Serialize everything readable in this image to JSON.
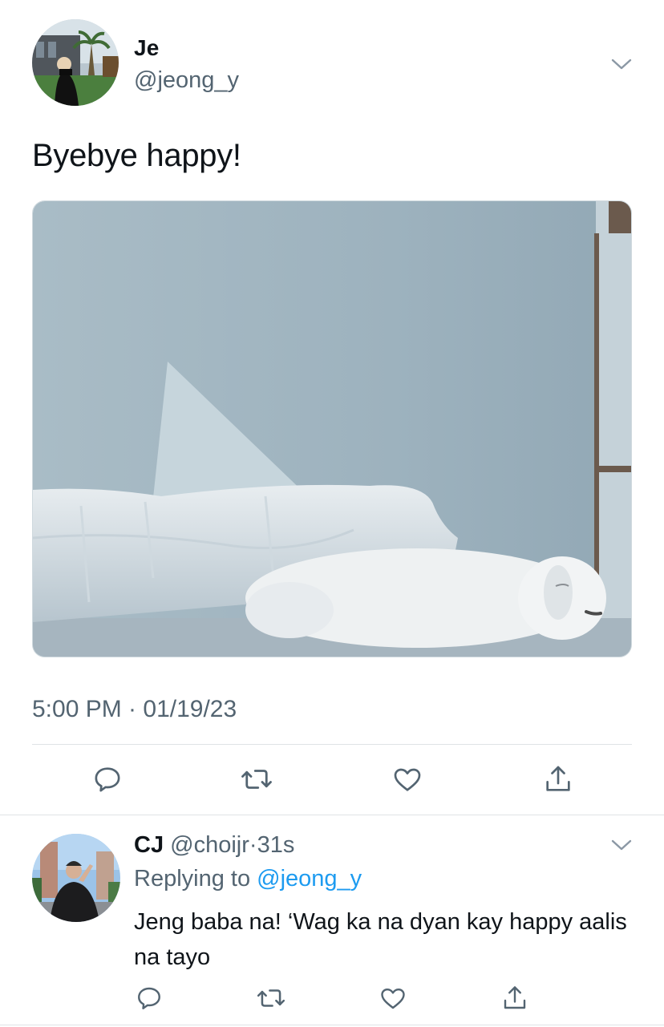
{
  "tweet": {
    "author_name": "Je",
    "author_handle": "@jeong_y",
    "text": "Byebye happy!",
    "timestamp": "5:00 PM · 01/19/23",
    "actions": [
      "reply-icon",
      "retweet-icon",
      "like-icon",
      "share-icon"
    ]
  },
  "reply": {
    "author_name": "CJ",
    "author_handle": "@choijr",
    "separator": "·",
    "time": "31s",
    "replying_prefix": "Replying to",
    "replying_handle": "@jeong_y",
    "text": "Jeng baba na! ‘Wag ka na dyan kay happy aalis na tayo",
    "actions": [
      "reply-icon",
      "retweet-icon",
      "like-icon",
      "share-icon"
    ]
  },
  "colors": {
    "secondary_text": "#536471",
    "link": "#1d9bf0",
    "divider": "#dfe3e6",
    "icon": "#536471"
  }
}
